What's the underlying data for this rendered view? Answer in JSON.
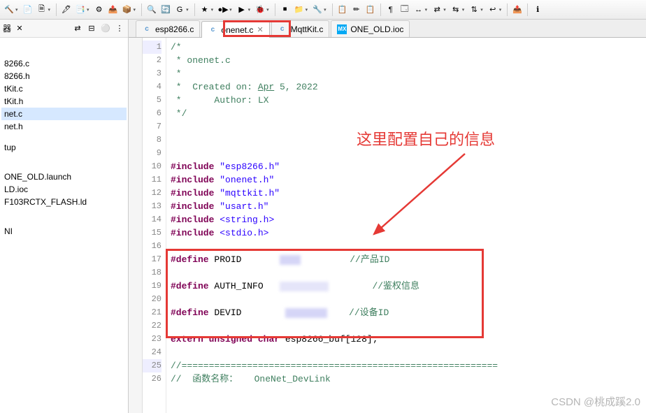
{
  "toolbar": {
    "icons": [
      "🔨",
      "📄",
      "🗎",
      "🖋",
      "📑",
      "⚙",
      "📤",
      "📦",
      "🔍",
      "🔄",
      "G",
      "★",
      "●▶",
      "▶",
      "🐞",
      "⏹",
      "📁",
      "🔧",
      "📋",
      "✏",
      "📋",
      "¶",
      "🗔",
      "↔",
      "⇄",
      "⇆",
      "⇅",
      "↩",
      "📤",
      "ℹ"
    ]
  },
  "sidebar": {
    "tab_label": "器",
    "close": "✕",
    "items": [
      "",
      "",
      "8266.c",
      "8266.h",
      "tKit.c",
      "tKit.h",
      "net.c",
      "net.h",
      "",
      "tup",
      "",
      "",
      "ONE_OLD.launch",
      "LD.ioc",
      "F103RCTX_FLASH.ld",
      "",
      "",
      "NI"
    ]
  },
  "tabs": [
    {
      "icon": "c",
      "label": "esp8266.c",
      "active": false
    },
    {
      "icon": "c",
      "label": "onenet.c",
      "active": true
    },
    {
      "icon": "c",
      "label": "MqttKit.c",
      "active": false
    },
    {
      "icon": "MX",
      "label": "ONE_OLD.ioc",
      "active": false
    }
  ],
  "code": {
    "lines": [
      {
        "n": 1,
        "html": "<span class='cm'>/*</span>"
      },
      {
        "n": 2,
        "html": "<span class='cm'> * onenet.c</span>"
      },
      {
        "n": 3,
        "html": "<span class='cm'> *</span>"
      },
      {
        "n": 4,
        "html": "<span class='cm'> *  Created on: <span style='text-decoration:underline'>Apr</span> 5, 2022</span>"
      },
      {
        "n": 5,
        "html": "<span class='cm'> *      Author: LX</span>"
      },
      {
        "n": 6,
        "html": "<span class='cm'> */</span>"
      },
      {
        "n": 7,
        "html": ""
      },
      {
        "n": 8,
        "html": ""
      },
      {
        "n": 9,
        "html": ""
      },
      {
        "n": 10,
        "html": "<span class='kw'>#include</span> <span class='str'>\"esp8266.h\"</span>"
      },
      {
        "n": 11,
        "html": "<span class='kw'>#include</span> <span class='str'>\"onenet.h\"</span>"
      },
      {
        "n": 12,
        "html": "<span class='kw'>#include</span> <span class='str'>\"mqttkit.h\"</span>"
      },
      {
        "n": 13,
        "html": "<span class='kw'>#include</span> <span class='str'>\"usart.h\"</span>"
      },
      {
        "n": 14,
        "html": "<span class='kw'>#include</span> <span class='str'>&lt;string.h&gt;</span>"
      },
      {
        "n": 15,
        "html": "<span class='kw'>#include</span> <span class='str'>&lt;stdio.h&gt;</span>"
      },
      {
        "n": 16,
        "html": ""
      },
      {
        "n": 17,
        "html": "<span class='kw'>#define</span> PROID       <span class='blur' style='width:30px'></span>         <span class='cm'>//产品ID</span>"
      },
      {
        "n": 18,
        "html": ""
      },
      {
        "n": 19,
        "html": "<span class='kw'>#define</span> AUTH_INFO   <span class='blur' style='width:70px;background:#e5e5f9'></span>        <span class='cm'>//鉴权信息</span>"
      },
      {
        "n": 20,
        "html": ""
      },
      {
        "n": 21,
        "html": "<span class='kw'>#define</span> DEVID        <span class='blur' style='width:60px'></span>    <span class='cm'>//设备ID</span>"
      },
      {
        "n": 22,
        "html": ""
      },
      {
        "n": 23,
        "html": "<span class='kw'>extern</span> <span class='kw'>unsigned</span> <span class='kw'>char</span> esp8266_buf[128];"
      },
      {
        "n": 24,
        "html": ""
      },
      {
        "n": 25,
        "html": "<span class='cm'>//==========================================================</span>"
      },
      {
        "n": 26,
        "html": "<span class='cm'>//  函数名称：   OneNet_DevLink</span>"
      }
    ]
  },
  "annotation": {
    "text": "这里配置自己的信息"
  },
  "watermark": "CSDN @桃成蹊2.0"
}
